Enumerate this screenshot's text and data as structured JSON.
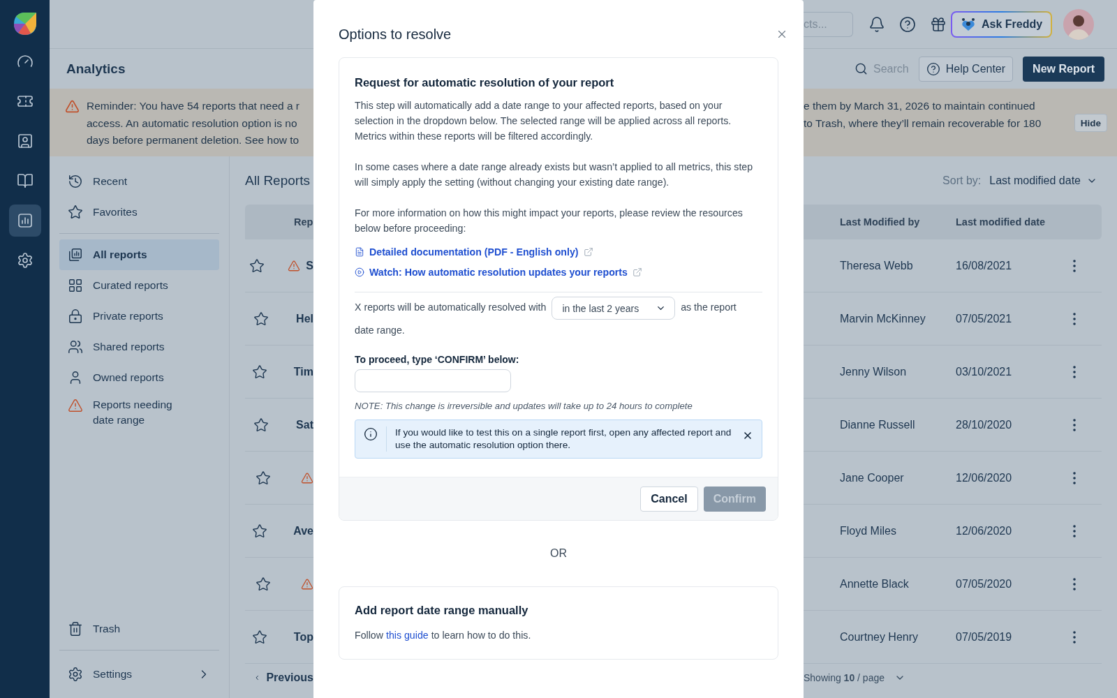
{
  "rail": {
    "items": [
      {
        "selected": false
      },
      {
        "selected": false
      },
      {
        "selected": false
      },
      {
        "selected": false
      },
      {
        "selected": true
      },
      {
        "selected": false
      }
    ]
  },
  "top_bar": {
    "search_placeholder": "cts...",
    "ask_button": "Ask Freddy"
  },
  "header": {
    "title": "Analytics",
    "search_placeholder": "Search",
    "help_button": "Help Center",
    "new_button": "New Report"
  },
  "banner": {
    "left_lines": [
      "Reminder: You have 54 reports that need a r",
      "access. An automatic resolution option is no",
      "days before permanent deletion. See how to"
    ],
    "right_lines": [
      "e them by March 31, 2026 to maintain continued",
      "to Trash, where they’ll remain recoverable for 180"
    ],
    "hide_button": "Hide"
  },
  "sidebar": {
    "groups": [
      [
        {
          "label": "Recent",
          "selected": false
        },
        {
          "label": "Favorites",
          "selected": false
        }
      ],
      [
        {
          "label": "All reports",
          "selected": true
        },
        {
          "label": "Curated reports",
          "selected": false
        },
        {
          "label": "Private reports",
          "selected": false
        },
        {
          "label": "Shared reports",
          "selected": false
        },
        {
          "label": "Owned reports",
          "selected": false
        },
        {
          "label": "Reports needing date range",
          "selected": false
        }
      ]
    ],
    "trash": "Trash",
    "settings": "Settings"
  },
  "reports": {
    "title": "All Reports",
    "sort_label": "Sort by:",
    "sort_value": "Last modified date",
    "columns": [
      "Rep",
      "Last Modified by",
      "Last modified date"
    ],
    "rows": [
      {
        "starred": false,
        "warning": true,
        "name": "S",
        "modified_by": "Theresa Webb",
        "date": "16/08/2021"
      },
      {
        "starred": false,
        "warning": false,
        "name": "Hel",
        "modified_by": "Marvin McKinney",
        "date": "07/05/2021"
      },
      {
        "starred": false,
        "warning": false,
        "name": "Tim",
        "modified_by": "Jenny Wilson",
        "date": "03/10/2021"
      },
      {
        "starred": false,
        "warning": false,
        "name": "Sat",
        "modified_by": "Dianne Russell",
        "date": "28/10/2020"
      },
      {
        "starred": false,
        "warning": true,
        "modified_by": "Jane Cooper",
        "date": "12/06/2020"
      },
      {
        "starred": false,
        "warning": false,
        "name": "Ave",
        "modified_by": "Floyd Miles",
        "date": "12/06/2020"
      },
      {
        "starred": false,
        "warning": true,
        "modified_by": "Annette Black",
        "date": "07/05/2020"
      },
      {
        "starred": false,
        "warning": false,
        "name": "Top",
        "modified_by": "Courtney Henry",
        "date": "07/05/2019"
      }
    ],
    "previous": "Previous",
    "page_size": "Showing **10** / page"
  },
  "modal": {
    "title": "Options to resolve",
    "auto": {
      "heading": "Request for automatic resolution of your report",
      "paragraphs": [
        "This step will automatically add a date range to your affected reports, based on your selection in the dropdown below. The selected range will be applied across all reports. Metrics within these reports will be filtered accordingly.",
        "In some cases where a date range already exists but wasn’t applied to all metrics, this step will simply apply the setting (without changing your existing date range).",
        "For more information on how this might impact your reports, please review the resources below before proceeding:"
      ],
      "links": [
        {
          "kind": "document",
          "label": "Detailed documentation (PDF - English only)"
        },
        {
          "kind": "video",
          "label": "Watch: How automatic resolution updates your reports"
        }
      ],
      "resolve_before": "X reports will be automatically resolved with",
      "range_select": "in the last 2 years",
      "resolve_after": "as the report date range.",
      "confirm_label": "To proceed, type ‘CONFIRM’ below:",
      "note": "NOTE: This change is irreversible and updates will take up to 24 hours to complete",
      "info": "If you would like to test this on a single report first, open any affected report and use the automatic resolution option there.",
      "cancel_button": "Cancel",
      "confirm_button": {
        "label": "Confirm",
        "disabled": true
      }
    },
    "or": "OR",
    "manual": {
      "heading": "Add report date range manually",
      "text_before": "Follow",
      "link": "this guide",
      "text_after": "to learn how to do this."
    }
  }
}
